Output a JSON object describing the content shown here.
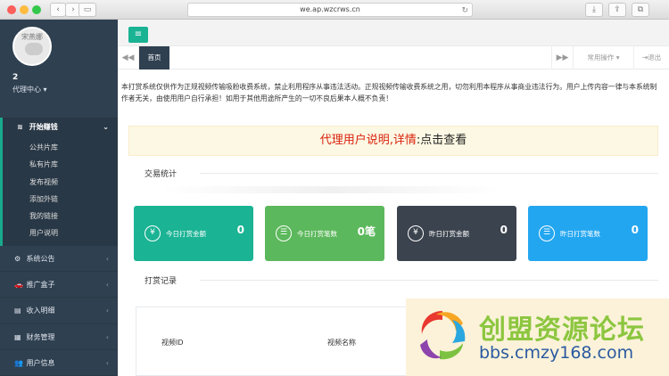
{
  "browser": {
    "url": "we.ap.wzcrws.cn",
    "back": "‹",
    "forward": "›",
    "sidebar": "▭",
    "reload": "↻",
    "download": "⤓",
    "share": "⇪",
    "tabs": "⧉"
  },
  "profile": {
    "avatar_label": "宋燕娜",
    "name": "2",
    "role": "代理中心 ▾"
  },
  "sidebar": {
    "active_group": {
      "icon": "≋",
      "label": "开始赚钱",
      "caret": "⌄",
      "items": [
        {
          "label": "公共片库"
        },
        {
          "label": "私有片库"
        },
        {
          "label": "发布视频"
        },
        {
          "label": "添加外链"
        },
        {
          "label": "我的链接"
        },
        {
          "label": "用户说明"
        }
      ]
    },
    "items": [
      {
        "icon": "⚙",
        "label": "系统公告",
        "caret": "‹"
      },
      {
        "icon": "🚗",
        "label": "推广盒子",
        "caret": "‹"
      },
      {
        "icon": "▤",
        "label": "收入明细",
        "caret": "‹"
      },
      {
        "icon": "▦",
        "label": "财务管理",
        "caret": "‹"
      },
      {
        "icon": "👥",
        "label": "用户信息",
        "caret": "‹"
      }
    ]
  },
  "topbar": {
    "menu_icon": "≡"
  },
  "tabs": {
    "prev": "◀◀",
    "home": "首页",
    "next": "▶▶",
    "actions": "常用操作 ▾",
    "logout": "⇥退出"
  },
  "content": {
    "disclaimer": "本打赏系统仅供作为正规视频传输吸粉收费系统，禁止利用程序从事违法活动。正规视频传输收费系统之用，切勿利用本程序从事商业违法行为。用户上传内容一律与本系统制作者无关，由使用用户自行承担！如用于其他用途所产生的一切不良后果本人概不负责！",
    "notice_red": "代理用户说明,详情",
    "notice_dark": ":点击查看",
    "stats_title": "交易统计",
    "records_title": "打赏记录",
    "cards": [
      {
        "icon": "¥",
        "label": "今日打赏金额",
        "value": "0"
      },
      {
        "icon": "☰",
        "label": "今日打赏笔数",
        "value": "0笔"
      },
      {
        "icon": "¥",
        "label": "昨日打赏金额",
        "value": "0"
      },
      {
        "icon": "☰",
        "label": "昨日打赏笔数",
        "value": "0"
      }
    ],
    "table_headers": [
      "视频ID",
      "视频名称"
    ]
  },
  "watermark": {
    "cn": "创盟资源论坛",
    "url": "bbs.cmzy168.com"
  },
  "colors": {
    "sidebar_bg": "#2f4050",
    "accent": "#1ab394",
    "card_green": "#5cb85c",
    "card_dark": "#3b434e",
    "card_blue": "#23a6f0",
    "notice_red": "#d9230f"
  }
}
